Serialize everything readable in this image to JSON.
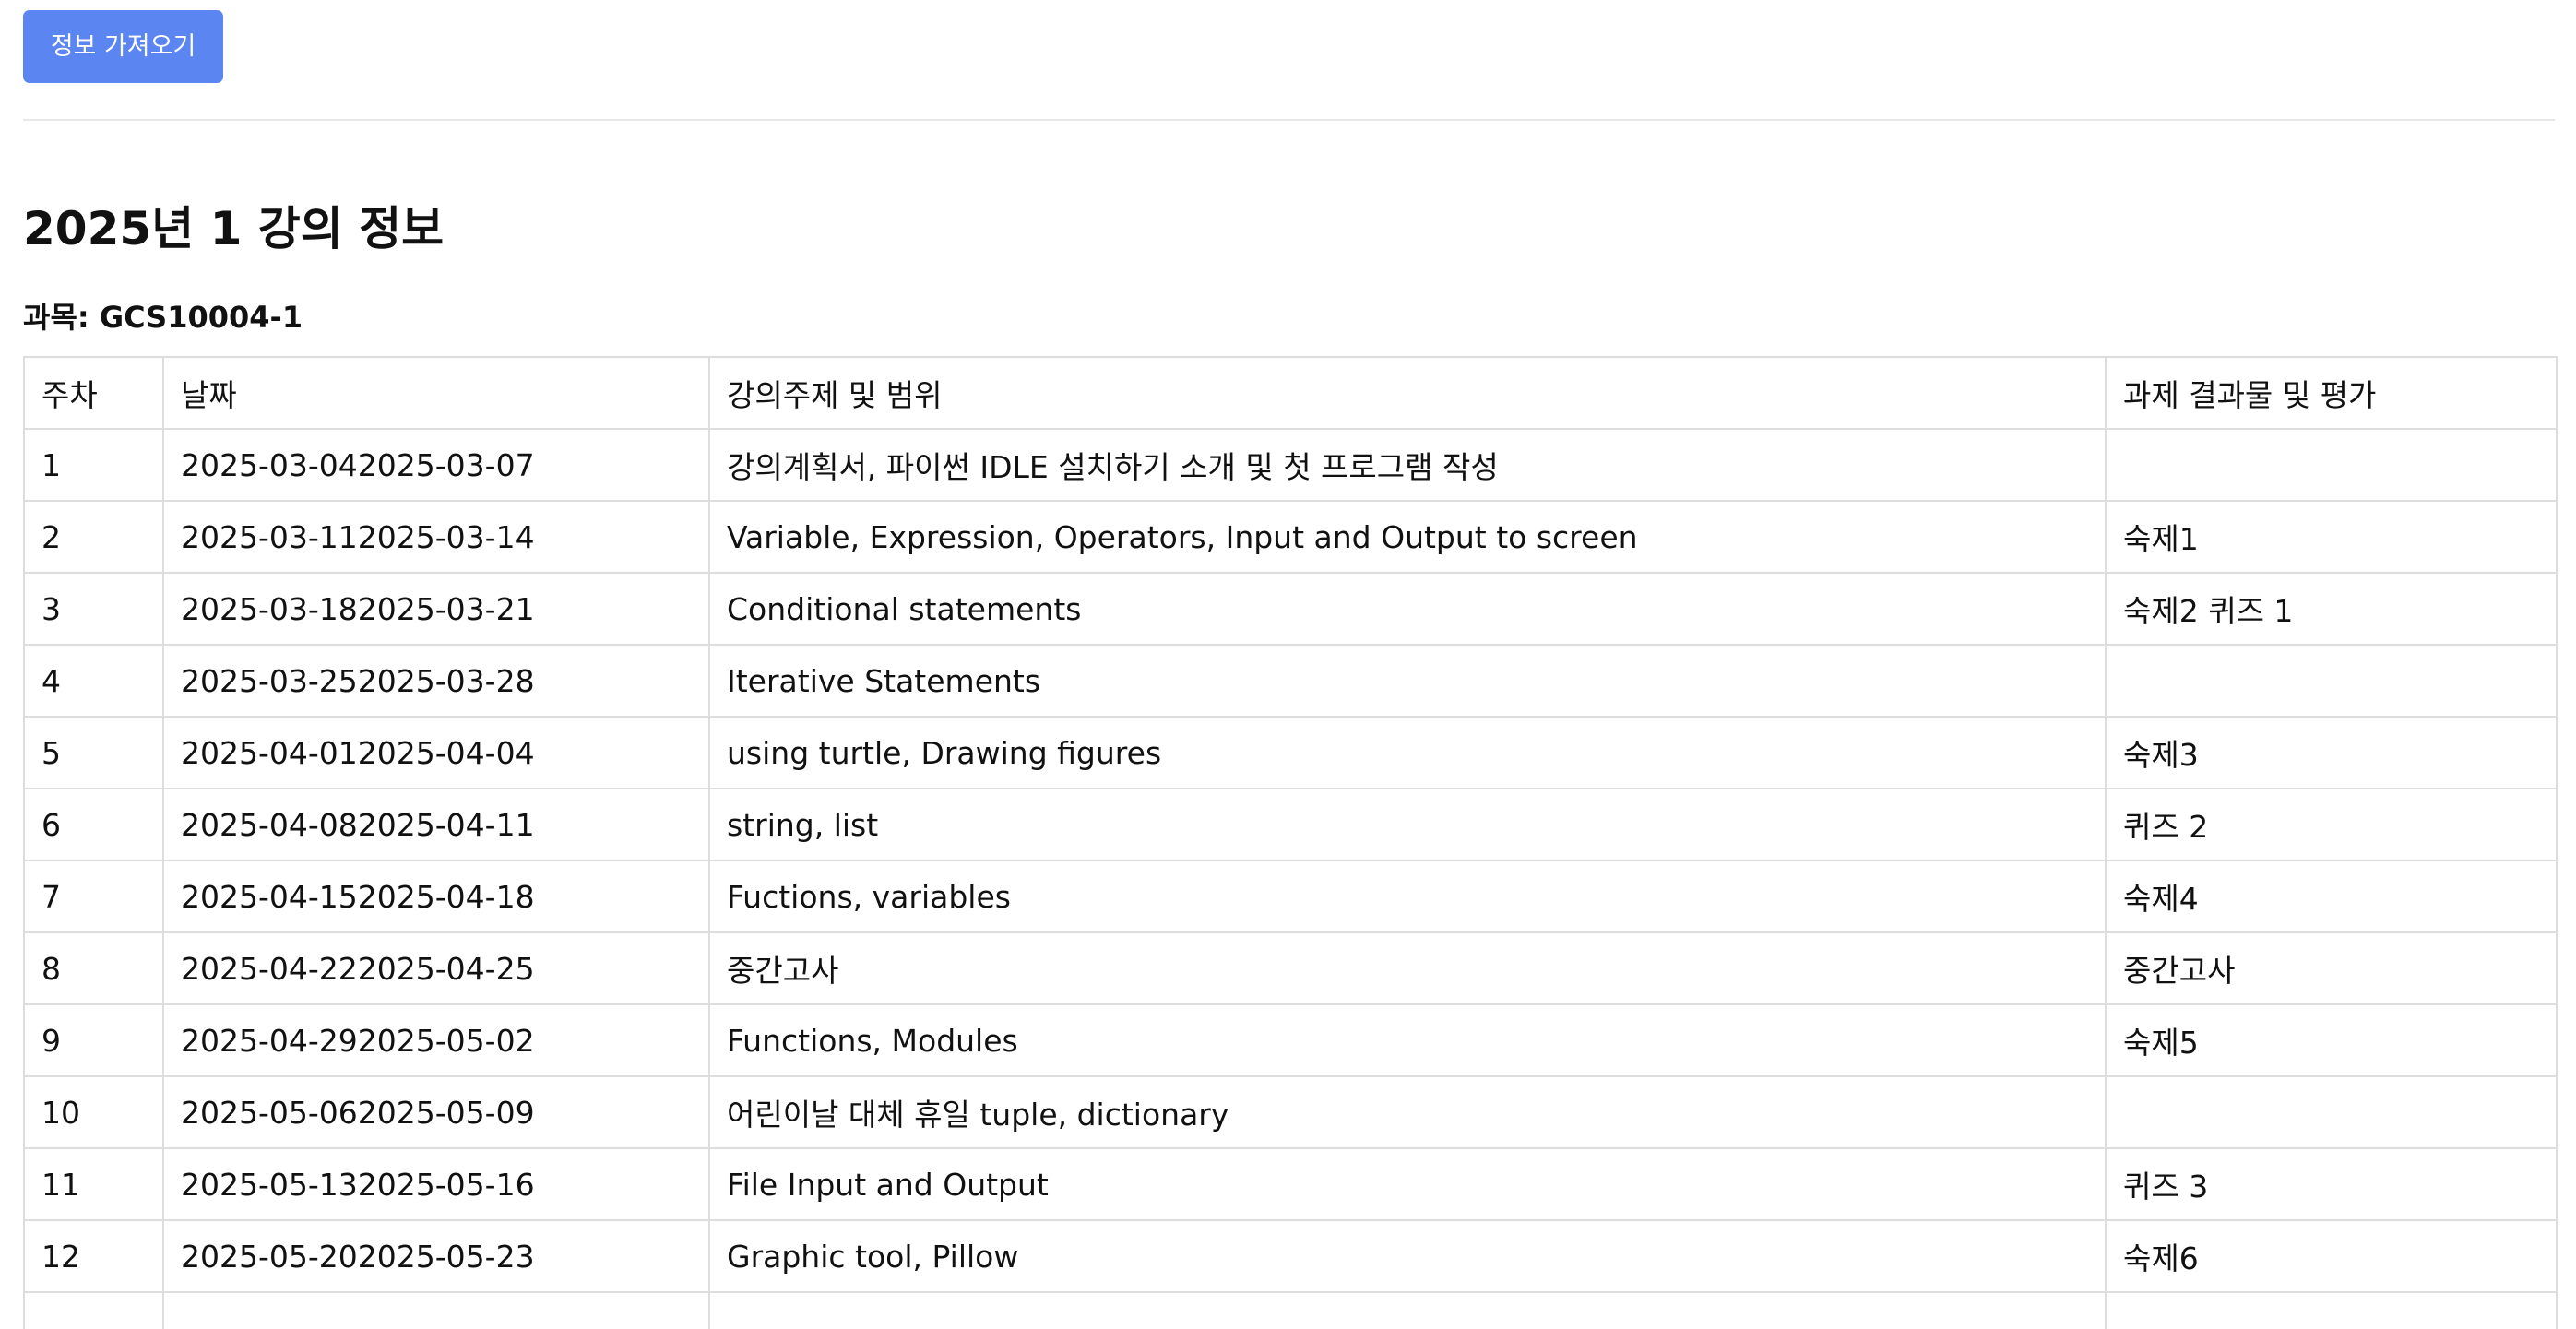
{
  "fetch_button_label": "정보 가져오기",
  "title": "2025년 1 강의 정보",
  "course": {
    "prefix": "과목:",
    "code": "GCS10004-1"
  },
  "table": {
    "headers": [
      "주차",
      "날짜",
      "강의주제 및 범위",
      "과제 결과물 및 평가"
    ],
    "rows": [
      [
        "1",
        "2025-03-042025-03-07",
        "강의계획서, 파이썬 IDLE 설치하기 소개 및 첫 프로그램 작성",
        ""
      ],
      [
        "2",
        "2025-03-112025-03-14",
        "Variable, Expression, Operators, Input and Output to screen",
        "숙제1"
      ],
      [
        "3",
        "2025-03-182025-03-21",
        "Conditional statements",
        "숙제2 퀴즈 1"
      ],
      [
        "4",
        "2025-03-252025-03-28",
        "Iterative Statements",
        ""
      ],
      [
        "5",
        "2025-04-012025-04-04",
        "using turtle, Drawing figures",
        "숙제3"
      ],
      [
        "6",
        "2025-04-082025-04-11",
        "string, list",
        "퀴즈 2"
      ],
      [
        "7",
        "2025-04-152025-04-18",
        "Fuctions, variables",
        "숙제4"
      ],
      [
        "8",
        "2025-04-222025-04-25",
        "중간고사",
        "중간고사"
      ],
      [
        "9",
        "2025-04-292025-05-02",
        "Functions, Modules",
        "숙제5"
      ],
      [
        "10",
        "2025-05-062025-05-09",
        "어린이날 대체 휴일 tuple, dictionary",
        ""
      ],
      [
        "11",
        "2025-05-132025-05-16",
        "File Input and Output",
        "퀴즈 3"
      ],
      [
        "12",
        "2025-05-202025-05-23",
        "Graphic tool, Pillow",
        "숙제6"
      ],
      [
        "",
        "",
        "",
        ""
      ]
    ]
  }
}
